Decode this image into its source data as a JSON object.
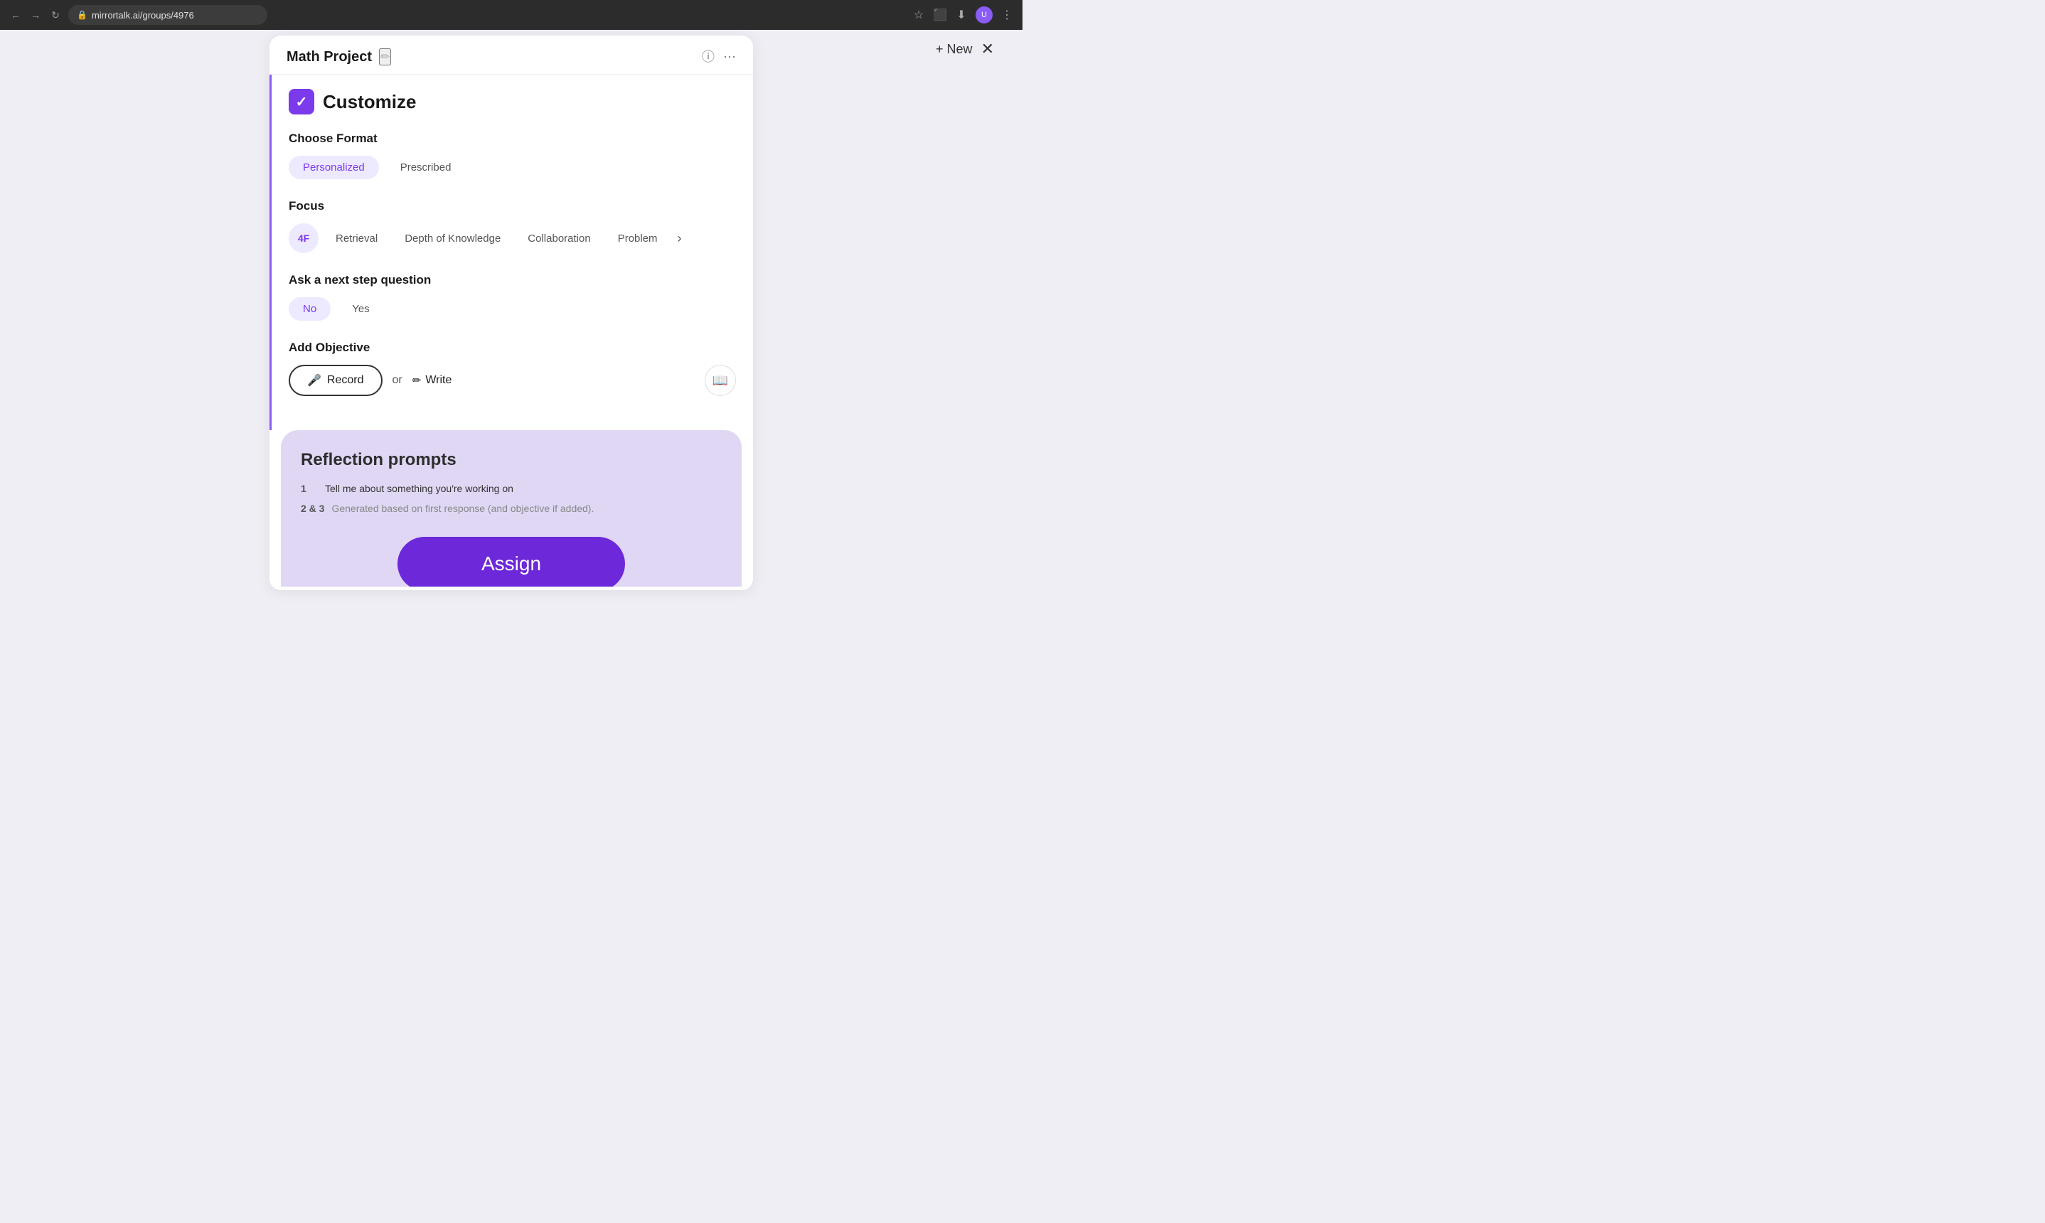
{
  "browser": {
    "url": "mirrortalk.ai/groups/4976",
    "back_title": "Back",
    "forward_title": "Forward",
    "refresh_title": "Refresh"
  },
  "top_controls": {
    "new_label": "+ New",
    "close_label": "✕"
  },
  "panel": {
    "title": "Math Project",
    "edit_icon": "✏",
    "info_icon": "ⓘ",
    "more_icon": "⋯"
  },
  "customize": {
    "check_icon": "✓",
    "section_title": "Customize",
    "choose_format": {
      "label": "Choose Format",
      "options": [
        {
          "value": "Personalized",
          "active": true
        },
        {
          "value": "Prescribed",
          "active": false
        }
      ]
    },
    "focus": {
      "label": "Focus",
      "options": [
        {
          "value": "4F",
          "active": true,
          "type": "circle"
        },
        {
          "value": "Retrieval",
          "active": false
        },
        {
          "value": "Depth of Knowledge",
          "active": false
        },
        {
          "value": "Collaboration",
          "active": false
        },
        {
          "value": "Problem",
          "active": false
        }
      ],
      "chevron": "›"
    },
    "next_step": {
      "label": "Ask a next step question",
      "options": [
        {
          "value": "No",
          "active": true
        },
        {
          "value": "Yes",
          "active": false
        }
      ]
    },
    "add_objective": {
      "label": "Add Objective",
      "record_label": "Record",
      "or_label": "or",
      "write_label": "Write",
      "mic_icon": "🎤",
      "pencil_icon": "✏",
      "book_icon": "📖"
    }
  },
  "reflection": {
    "title": "Reflection prompts",
    "item1_num": "1",
    "item1_text": "Tell me about something you're working on",
    "item23_num": "2 & 3",
    "item23_text": "Generated based on first response (and objective if added)."
  },
  "assign": {
    "label": "Assign"
  }
}
